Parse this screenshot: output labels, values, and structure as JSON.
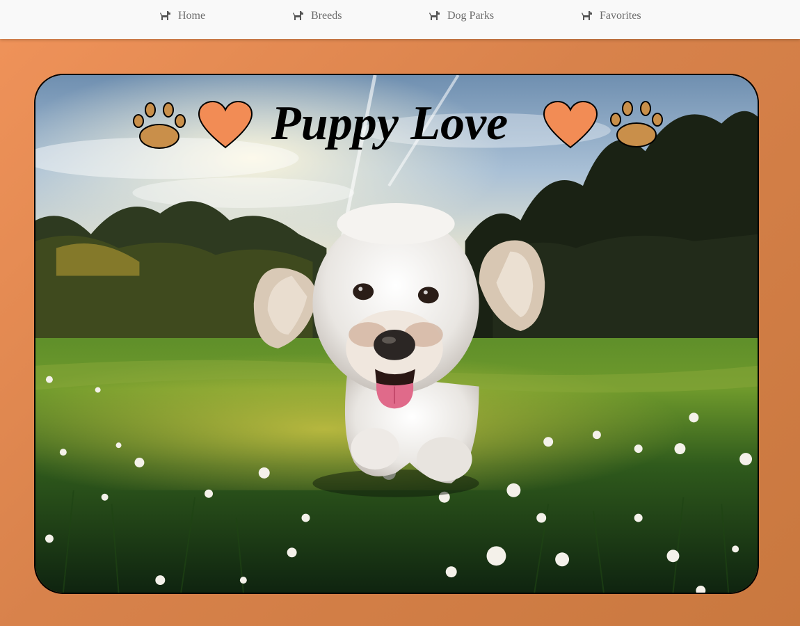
{
  "nav": {
    "items": [
      {
        "label": "Home",
        "icon": "dog-icon"
      },
      {
        "label": "Breeds",
        "icon": "dog-icon"
      },
      {
        "label": "Dog Parks",
        "icon": "dog-icon"
      },
      {
        "label": "Favorites",
        "icon": "dog-icon"
      }
    ]
  },
  "hero": {
    "title": "Puppy Love",
    "image": "white-puppy-running-in-grass-photo",
    "decorations": [
      "paw-icon",
      "heart-icon",
      "heart-icon",
      "paw-icon"
    ]
  },
  "colors": {
    "background": "#e08a50",
    "navbar": "#f9f9f9",
    "heart": "#f28c55",
    "paw": "#c98f4a",
    "nav_text": "#6b6b6b"
  }
}
